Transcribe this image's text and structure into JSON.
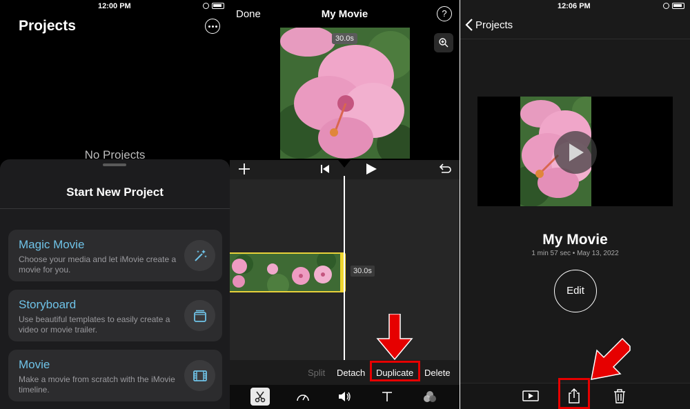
{
  "colors": {
    "panel_bg": "#000000",
    "sheet_bg": "#1c1c1e",
    "card_bg": "#2c2c2e",
    "card_title": "#6fc3e8",
    "highlight": "#e60000",
    "clip_border": "#e8d23a"
  },
  "screen1": {
    "status_time": "12:00 PM",
    "title": "Projects",
    "more_icon": "ellipsis-circle-icon",
    "empty_label": "No Projects",
    "sheet": {
      "title": "Start New Project",
      "cards": [
        {
          "title": "Magic Movie",
          "desc": "Choose your media and let iMovie create a movie for you.",
          "icon": "magic-wand-icon"
        },
        {
          "title": "Storyboard",
          "desc": "Use beautiful templates to easily create a video or movie trailer.",
          "icon": "storyboard-icon"
        },
        {
          "title": "Movie",
          "desc": "Make a movie from scratch with the iMovie timeline.",
          "icon": "film-icon"
        }
      ]
    }
  },
  "screen2": {
    "done_label": "Done",
    "title": "My Movie",
    "preview_duration": "30.0s",
    "clip_duration": "30.0s",
    "actions": {
      "split": "Split",
      "detach": "Detach",
      "duplicate": "Duplicate",
      "delete": "Delete"
    },
    "highlighted_action": "Duplicate",
    "tools": [
      "scissors-icon",
      "speedometer-icon",
      "volume-icon",
      "text-icon",
      "filters-icon"
    ]
  },
  "screen3": {
    "status_time": "12:06 PM",
    "back_label": "Projects",
    "movie_title": "My Movie",
    "meta": "1 min 57 sec • May 13, 2022",
    "edit_label": "Edit",
    "bottom_icons": [
      "play-icon",
      "share-icon",
      "trash-icon"
    ],
    "highlighted_icon": "share-icon"
  }
}
